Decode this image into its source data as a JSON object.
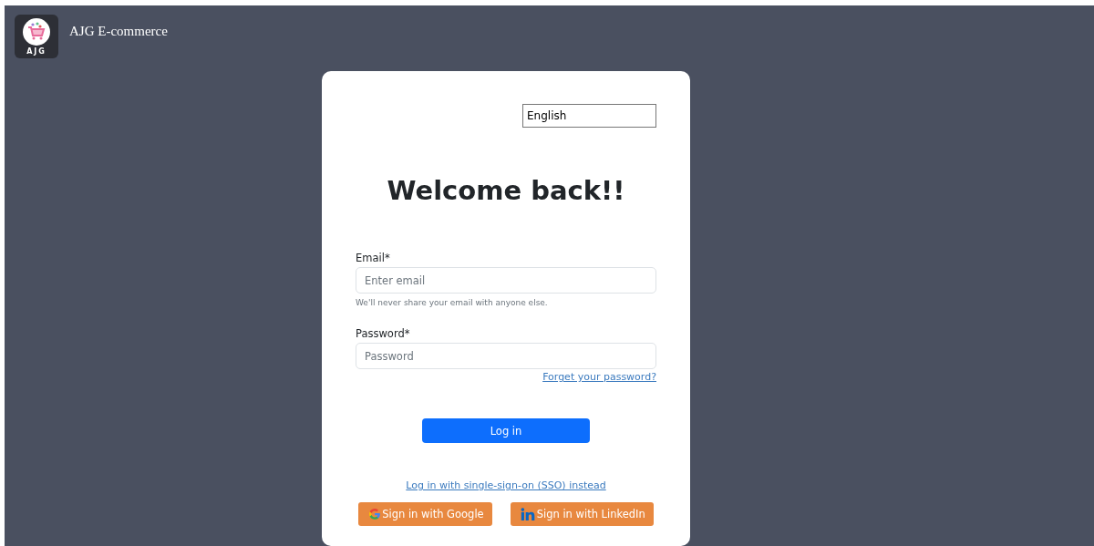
{
  "header": {
    "logo_text": "AJG",
    "title": "AJG E-commerce"
  },
  "language": {
    "value": "English"
  },
  "heading": "Welcome back!!",
  "fields": [
    {
      "label": "Email*",
      "placeholder": "Enter email",
      "help": "We'll never share your email with anyone else."
    },
    {
      "label": "Password*",
      "placeholder": "Password"
    }
  ],
  "forgot_link": "Forget your password?",
  "login_button": "Log in",
  "sso_link": "Log in with single-sign-on (SSO) instead",
  "social_buttons": [
    {
      "label": "Sign in with Google",
      "kind": "google"
    },
    {
      "label": "Sign in with LinkedIn",
      "kind": "linkedin"
    }
  ]
}
